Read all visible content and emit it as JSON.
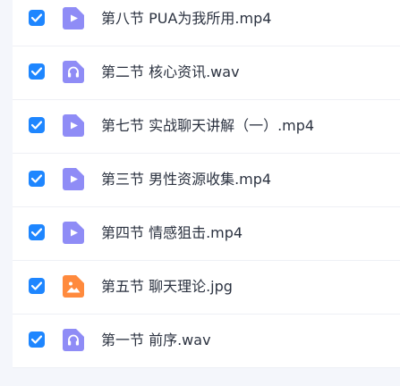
{
  "colors": {
    "checkbox": "#1e86ff",
    "video_icon": "#8f8cf6",
    "audio_icon": "#8f8cf6",
    "image_icon": "#ff8a3d",
    "text": "#2b3240"
  },
  "files": [
    {
      "name": "第八节 PUA为我所用.mp4",
      "type": "video",
      "icon": "video-file-icon",
      "checked": true
    },
    {
      "name": "第二节 核心资讯.wav",
      "type": "audio",
      "icon": "audio-file-icon",
      "checked": true
    },
    {
      "name": "第七节 实战聊天讲解（一）.mp4",
      "type": "video",
      "icon": "video-file-icon",
      "checked": true
    },
    {
      "name": "第三节 男性资源收集.mp4",
      "type": "video",
      "icon": "video-file-icon",
      "checked": true
    },
    {
      "name": "第四节 情感狙击.mp4",
      "type": "video",
      "icon": "video-file-icon",
      "checked": true
    },
    {
      "name": "第五节 聊天理论.jpg",
      "type": "image",
      "icon": "image-file-icon",
      "checked": true
    },
    {
      "name": "第一节 前序.wav",
      "type": "audio",
      "icon": "audio-file-icon",
      "checked": true
    }
  ]
}
